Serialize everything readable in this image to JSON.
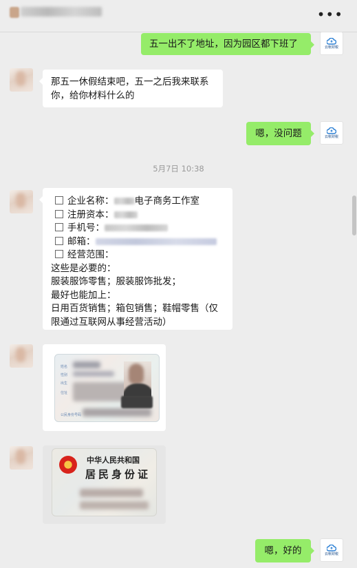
{
  "header": {
    "more_label": "•••"
  },
  "messages": {
    "m1": "五一出不了地址，因为园区都下班了",
    "m2": "那五一休假结束吧，五一之后我来联系你，给你材料什么的",
    "m3": "嗯，没问题",
    "timestamp": "5月7日 10:38",
    "m4": {
      "lines": [
        {
          "text": "企业名称：",
          "suffix": "电子商务工作室"
        },
        {
          "text": "注册资本：",
          "suffix": ""
        },
        {
          "text": "手机号：",
          "suffix": ""
        },
        {
          "text": "邮箱：",
          "suffix": ""
        },
        {
          "text": "经营范围：",
          "suffix": ""
        }
      ],
      "body": [
        "这些是必要的：",
        "服装服饰零售；服装服饰批发；",
        "最好也能加上：",
        "日用百货销售；箱包销售；鞋帽零售（仅",
        "限通过互联网从事经营活动）"
      ]
    },
    "m5": "嗯，好的"
  },
  "idcard_back": {
    "line1": "中华人民共和国",
    "line2": "居民身份证"
  },
  "avatar_logo": "云帐财税",
  "colors": {
    "background": "#ededed",
    "bubble_right": "#95ec69",
    "bubble_left": "#ffffff",
    "timestamp": "#9a9a9a"
  }
}
